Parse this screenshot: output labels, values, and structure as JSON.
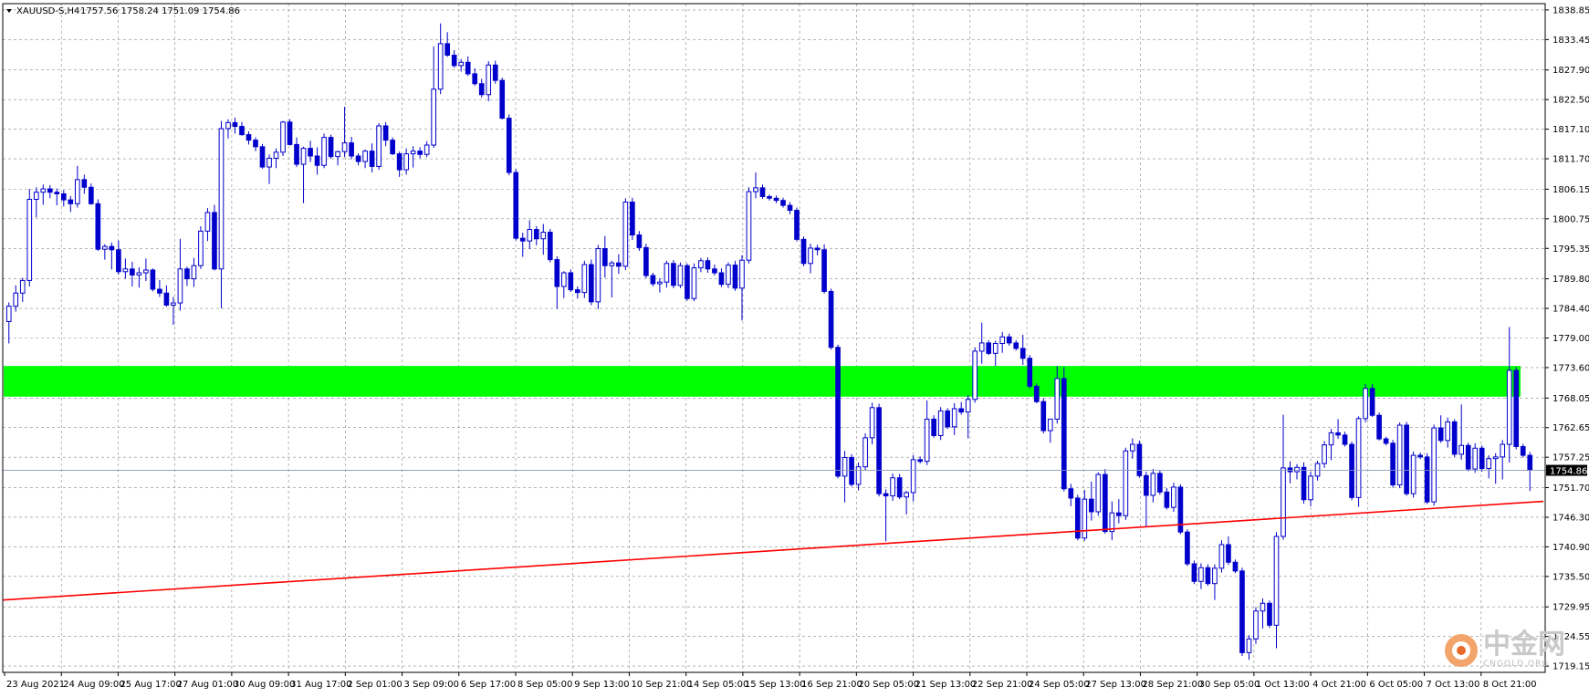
{
  "header": {
    "menu_arrow": "dropdown-arrow-icon",
    "symbol": "XAUUSD-S,H4",
    "ohlc": "1757.56 1758.24 1751.09 1754.86"
  },
  "price_label": "1754.86",
  "watermark": {
    "logo": "cngold-logo-icon",
    "text": "中金网",
    "url": "CNGOLD.ORG"
  },
  "colors": {
    "grid": "#8a8a8a",
    "bull_candle": "#ffffff",
    "bear_candle": "#0000cc",
    "wick": "#0000cc",
    "zone": "#00ff00",
    "trendline": "#ff0000",
    "price_line": "#8899bb",
    "price_label_bg": "#000000"
  },
  "chart_data": {
    "type": "candlestick",
    "symbol": "XAUUSD-S",
    "timeframe": "H4",
    "y_ticks": [
      "1838.85",
      "1833.45",
      "1827.90",
      "1822.50",
      "1817.10",
      "1811.70",
      "1806.15",
      "1800.75",
      "1795.35",
      "1789.80",
      "1784.40",
      "1779.00",
      "1773.60",
      "1768.05",
      "1762.65",
      "1757.25",
      "1751.70",
      "1746.30",
      "1740.90",
      "1735.50",
      "1729.95",
      "1724.55",
      "1719.15"
    ],
    "x_labels": [
      "23 Aug 2021",
      "24 Aug 09:00",
      "25 Aug 17:00",
      "27 Aug 01:00",
      "30 Aug 09:00",
      "31 Aug 17:00",
      "2 Sep 01:00",
      "3 Sep 09:00",
      "6 Sep 17:00",
      "8 Sep 05:00",
      "9 Sep 13:00",
      "10 Sep 21:00",
      "14 Sep 05:00",
      "15 Sep 13:00",
      "16 Sep 21:00",
      "20 Sep 05:00",
      "21 Sep 13:00",
      "22 Sep 21:00",
      "24 Sep 05:00",
      "27 Sep 13:00",
      "28 Sep 21:00",
      "30 Sep 05:00",
      "1 Oct 13:00",
      "4 Oct 21:00",
      "6 Oct 05:00",
      "7 Oct 13:00",
      "8 Oct 21:00"
    ],
    "ylim": [
      1718.0,
      1840.0
    ],
    "current_price": 1754.86,
    "resistance_zone": [
      1768.3,
      1773.9
    ],
    "trendline": [
      [
        0,
        1731.2
      ],
      [
        1537,
        1749.2
      ]
    ],
    "candles": [
      [
        1782.0,
        1785.5,
        1778.0,
        1784.8
      ],
      [
        1784.8,
        1788.6,
        1783.8,
        1787.2
      ],
      [
        1787.2,
        1790.0,
        1785.6,
        1789.5
      ],
      [
        1789.5,
        1806.2,
        1788.4,
        1804.3
      ],
      [
        1804.3,
        1806.5,
        1801.0,
        1805.6
      ],
      [
        1805.6,
        1807.0,
        1803.3,
        1806.2
      ],
      [
        1806.2,
        1806.9,
        1804.5,
        1805.6
      ],
      [
        1805.6,
        1806.3,
        1803.2,
        1805.3
      ],
      [
        1805.3,
        1806.0,
        1803.0,
        1804.2
      ],
      [
        1804.2,
        1804.9,
        1802.0,
        1803.5
      ],
      [
        1803.5,
        1810.4,
        1802.8,
        1807.9
      ],
      [
        1807.9,
        1808.8,
        1805.3,
        1806.5
      ],
      [
        1806.5,
        1807.2,
        1803.3,
        1803.5
      ],
      [
        1803.5,
        1804.3,
        1794.9,
        1795.2
      ],
      [
        1795.2,
        1796.1,
        1793.3,
        1795.7
      ],
      [
        1795.7,
        1796.4,
        1791.5,
        1795.1
      ],
      [
        1795.1,
        1796.8,
        1790.6,
        1791.1
      ],
      [
        1791.1,
        1793.5,
        1789.8,
        1791.6
      ],
      [
        1791.6,
        1792.9,
        1788.4,
        1790.5
      ],
      [
        1790.5,
        1791.9,
        1788.2,
        1790.9
      ],
      [
        1790.9,
        1793.5,
        1789.4,
        1791.4
      ],
      [
        1791.4,
        1791.7,
        1787.5,
        1787.9
      ],
      [
        1787.9,
        1789.6,
        1786.5,
        1787.2
      ],
      [
        1787.2,
        1788.6,
        1784.7,
        1785.0
      ],
      [
        1785.0,
        1786.5,
        1781.4,
        1785.4
      ],
      [
        1785.4,
        1797.1,
        1784.0,
        1791.6
      ],
      [
        1791.6,
        1792.0,
        1788.5,
        1789.8
      ],
      [
        1789.8,
        1793.6,
        1788.3,
        1792.2
      ],
      [
        1792.2,
        1799.4,
        1791.6,
        1798.5
      ],
      [
        1798.5,
        1802.7,
        1796.7,
        1801.9
      ],
      [
        1801.9,
        1803.3,
        1791.3,
        1791.6
      ],
      [
        1791.6,
        1818.6,
        1784.4,
        1817.2
      ],
      [
        1817.2,
        1818.9,
        1815.4,
        1818.3
      ],
      [
        1818.3,
        1819.2,
        1816.3,
        1817.6
      ],
      [
        1817.6,
        1818.4,
        1815.9,
        1816.1
      ],
      [
        1816.1,
        1816.7,
        1814.3,
        1815.1
      ],
      [
        1815.1,
        1815.6,
        1813.1,
        1813.9
      ],
      [
        1813.9,
        1814.4,
        1809.9,
        1810.2
      ],
      [
        1810.2,
        1812.5,
        1807.1,
        1811.8
      ],
      [
        1811.8,
        1813.6,
        1810.0,
        1812.9
      ],
      [
        1812.9,
        1818.6,
        1812.2,
        1818.4
      ],
      [
        1818.4,
        1818.9,
        1814.1,
        1814.3
      ],
      [
        1814.3,
        1815.6,
        1810.2,
        1810.7
      ],
      [
        1810.7,
        1813.9,
        1803.6,
        1813.6
      ],
      [
        1813.6,
        1815.0,
        1811.1,
        1812.2
      ],
      [
        1812.2,
        1813.8,
        1808.8,
        1810.5
      ],
      [
        1810.5,
        1816.3,
        1810.0,
        1815.6
      ],
      [
        1815.6,
        1816.1,
        1811.7,
        1812.1
      ],
      [
        1812.1,
        1813.2,
        1810.5,
        1813.0
      ],
      [
        1813.0,
        1821.2,
        1812.0,
        1814.6
      ],
      [
        1814.6,
        1815.7,
        1811.6,
        1812.2
      ],
      [
        1812.2,
        1812.7,
        1810.5,
        1811.2
      ],
      [
        1811.2,
        1813.4,
        1810.0,
        1813.1
      ],
      [
        1813.1,
        1814.5,
        1809.2,
        1810.3
      ],
      [
        1810.3,
        1818.2,
        1809.7,
        1817.7
      ],
      [
        1817.7,
        1818.4,
        1814.0,
        1815.1
      ],
      [
        1815.1,
        1815.6,
        1812.4,
        1812.6
      ],
      [
        1812.6,
        1813.0,
        1808.4,
        1809.7
      ],
      [
        1809.7,
        1813.6,
        1808.8,
        1812.6
      ],
      [
        1812.6,
        1814.0,
        1810.1,
        1813.1
      ],
      [
        1813.1,
        1813.8,
        1811.8,
        1812.5
      ],
      [
        1812.5,
        1814.9,
        1812.0,
        1814.2
      ],
      [
        1814.2,
        1832.2,
        1813.7,
        1824.4
      ],
      [
        1824.4,
        1836.4,
        1823.5,
        1832.7
      ],
      [
        1832.7,
        1834.8,
        1830.3,
        1830.6
      ],
      [
        1830.6,
        1831.5,
        1828.3,
        1828.7
      ],
      [
        1828.7,
        1829.9,
        1827.6,
        1829.3
      ],
      [
        1829.3,
        1830.4,
        1826.8,
        1827.2
      ],
      [
        1827.2,
        1828.2,
        1825.0,
        1825.4
      ],
      [
        1825.4,
        1826.3,
        1822.9,
        1823.4
      ],
      [
        1823.4,
        1829.5,
        1822.2,
        1828.8
      ],
      [
        1828.8,
        1829.6,
        1825.4,
        1826.0
      ],
      [
        1826.0,
        1826.5,
        1818.9,
        1819.1
      ],
      [
        1819.1,
        1819.8,
        1808.7,
        1809.2
      ],
      [
        1809.2,
        1809.8,
        1796.8,
        1797.2
      ],
      [
        1797.2,
        1798.2,
        1793.8,
        1796.7
      ],
      [
        1796.7,
        1800.5,
        1795.2,
        1798.8
      ],
      [
        1798.8,
        1799.4,
        1795.9,
        1797.1
      ],
      [
        1797.1,
        1799.8,
        1794.2,
        1798.3
      ],
      [
        1798.3,
        1798.9,
        1792.8,
        1793.3
      ],
      [
        1793.3,
        1793.9,
        1784.3,
        1788.4
      ],
      [
        1788.4,
        1791.2,
        1786.3,
        1790.9
      ],
      [
        1790.9,
        1791.5,
        1787.4,
        1787.8
      ],
      [
        1787.8,
        1788.4,
        1786.2,
        1787.3
      ],
      [
        1787.3,
        1793.1,
        1786.3,
        1792.4
      ],
      [
        1792.4,
        1793.3,
        1785.0,
        1785.6
      ],
      [
        1785.6,
        1796.0,
        1784.3,
        1795.3
      ],
      [
        1795.3,
        1797.6,
        1790.0,
        1792.2
      ],
      [
        1792.2,
        1793.1,
        1786.4,
        1792.7
      ],
      [
        1792.7,
        1794.3,
        1790.7,
        1792.1
      ],
      [
        1792.1,
        1804.5,
        1791.4,
        1803.8
      ],
      [
        1803.8,
        1804.6,
        1796.9,
        1797.8
      ],
      [
        1797.8,
        1798.5,
        1794.9,
        1795.5
      ],
      [
        1795.5,
        1796.2,
        1789.9,
        1790.4
      ],
      [
        1790.4,
        1790.9,
        1788.4,
        1788.9
      ],
      [
        1788.9,
        1789.9,
        1787.3,
        1789.2
      ],
      [
        1789.2,
        1793.1,
        1788.2,
        1792.6
      ],
      [
        1792.6,
        1793.2,
        1788.1,
        1788.6
      ],
      [
        1788.6,
        1792.8,
        1788.1,
        1792.2
      ],
      [
        1792.2,
        1792.6,
        1785.8,
        1786.2
      ],
      [
        1786.2,
        1792.6,
        1785.7,
        1791.8
      ],
      [
        1791.8,
        1793.6,
        1791.0,
        1793.1
      ],
      [
        1793.1,
        1793.7,
        1790.9,
        1791.6
      ],
      [
        1791.6,
        1792.4,
        1790.4,
        1790.9
      ],
      [
        1790.9,
        1791.7,
        1788.3,
        1788.8
      ],
      [
        1788.8,
        1792.8,
        1788.1,
        1792.3
      ],
      [
        1792.3,
        1793.1,
        1787.6,
        1788.1
      ],
      [
        1788.1,
        1794.1,
        1782.2,
        1793.2
      ],
      [
        1793.2,
        1806.5,
        1792.6,
        1805.7
      ],
      [
        1805.7,
        1809.2,
        1804.5,
        1806.4
      ],
      [
        1806.4,
        1807.0,
        1804.4,
        1804.8
      ],
      [
        1804.8,
        1805.2,
        1804.1,
        1804.5
      ],
      [
        1804.5,
        1805.0,
        1803.6,
        1804.1
      ],
      [
        1804.1,
        1804.6,
        1802.8,
        1803.2
      ],
      [
        1803.2,
        1803.8,
        1801.6,
        1802.3
      ],
      [
        1802.3,
        1802.8,
        1796.6,
        1797.0
      ],
      [
        1797.0,
        1797.5,
        1792.1,
        1792.6
      ],
      [
        1792.6,
        1796.2,
        1790.8,
        1795.4
      ],
      [
        1795.4,
        1796.0,
        1794.1,
        1795.1
      ],
      [
        1795.1,
        1796.1,
        1787.1,
        1787.5
      ],
      [
        1787.5,
        1788.0,
        1776.9,
        1777.3
      ],
      [
        1777.3,
        1777.8,
        1753.4,
        1753.8
      ],
      [
        1753.8,
        1758.4,
        1749.0,
        1757.2
      ],
      [
        1757.2,
        1757.8,
        1751.9,
        1752.3
      ],
      [
        1752.3,
        1756.3,
        1751.2,
        1755.5
      ],
      [
        1755.5,
        1761.6,
        1754.8,
        1760.8
      ],
      [
        1760.8,
        1767.2,
        1759.6,
        1766.3
      ],
      [
        1766.3,
        1767.0,
        1750.1,
        1750.6
      ],
      [
        1750.6,
        1751.4,
        1741.9,
        1750.2
      ],
      [
        1750.2,
        1754.3,
        1749.3,
        1753.5
      ],
      [
        1753.5,
        1754.2,
        1749.6,
        1750.0
      ],
      [
        1750.0,
        1751.1,
        1746.8,
        1750.8
      ],
      [
        1750.8,
        1757.6,
        1749.2,
        1756.8
      ],
      [
        1756.8,
        1757.4,
        1756.1,
        1756.5
      ],
      [
        1756.5,
        1767.6,
        1755.8,
        1764.2
      ],
      [
        1764.2,
        1764.9,
        1760.8,
        1761.2
      ],
      [
        1761.2,
        1766.4,
        1760.4,
        1765.7
      ],
      [
        1765.7,
        1766.2,
        1762.4,
        1762.8
      ],
      [
        1762.8,
        1767.1,
        1761.3,
        1766.1
      ],
      [
        1766.1,
        1767.3,
        1765.0,
        1765.5
      ],
      [
        1765.5,
        1768.6,
        1760.7,
        1767.8
      ],
      [
        1767.8,
        1777.3,
        1767.2,
        1776.6
      ],
      [
        1776.6,
        1781.8,
        1774.3,
        1778.1
      ],
      [
        1778.1,
        1778.6,
        1775.9,
        1776.2
      ],
      [
        1776.2,
        1778.5,
        1773.9,
        1778.0
      ],
      [
        1778.0,
        1780.1,
        1776.3,
        1779.2
      ],
      [
        1779.2,
        1779.8,
        1777.6,
        1778.1
      ],
      [
        1778.1,
        1778.6,
        1776.7,
        1777.1
      ],
      [
        1777.1,
        1779.6,
        1774.1,
        1775.3
      ],
      [
        1775.3,
        1775.9,
        1769.8,
        1770.2
      ],
      [
        1770.2,
        1770.7,
        1767.1,
        1767.4
      ],
      [
        1767.4,
        1768.0,
        1761.6,
        1762.1
      ],
      [
        1762.1,
        1763.0,
        1759.9,
        1764.2
      ],
      [
        1764.2,
        1773.9,
        1763.4,
        1771.6
      ],
      [
        1771.6,
        1773.7,
        1751.0,
        1751.5
      ],
      [
        1751.5,
        1752.4,
        1748.3,
        1749.8
      ],
      [
        1749.8,
        1750.4,
        1742.1,
        1742.5
      ],
      [
        1742.5,
        1751.3,
        1742.0,
        1749.6
      ],
      [
        1749.6,
        1752.8,
        1745.7,
        1747.3
      ],
      [
        1747.3,
        1754.5,
        1746.6,
        1754.1
      ],
      [
        1754.1,
        1755.1,
        1743.3,
        1743.7
      ],
      [
        1743.7,
        1749.2,
        1742.1,
        1747.1
      ],
      [
        1747.1,
        1749.6,
        1745.2,
        1746.6
      ],
      [
        1746.6,
        1759.0,
        1745.8,
        1758.4
      ],
      [
        1758.4,
        1760.7,
        1757.0,
        1759.6
      ],
      [
        1759.6,
        1760.3,
        1753.5,
        1753.9
      ],
      [
        1753.9,
        1754.6,
        1744.5,
        1750.3
      ],
      [
        1750.3,
        1755.1,
        1749.0,
        1754.3
      ],
      [
        1754.3,
        1754.9,
        1750.4,
        1750.9
      ],
      [
        1750.9,
        1751.6,
        1747.7,
        1748.1
      ],
      [
        1748.1,
        1752.6,
        1747.3,
        1751.8
      ],
      [
        1751.8,
        1752.3,
        1743.2,
        1743.6
      ],
      [
        1743.6,
        1744.1,
        1737.4,
        1737.8
      ],
      [
        1737.8,
        1738.4,
        1734.1,
        1734.6
      ],
      [
        1734.6,
        1737.9,
        1733.2,
        1737.1
      ],
      [
        1737.1,
        1737.7,
        1733.8,
        1734.2
      ],
      [
        1734.2,
        1737.7,
        1731.2,
        1737.0
      ],
      [
        1737.0,
        1742.1,
        1736.2,
        1741.3
      ],
      [
        1741.3,
        1742.8,
        1737.6,
        1738.1
      ],
      [
        1738.1,
        1738.6,
        1736.1,
        1736.5
      ],
      [
        1736.5,
        1737.1,
        1721.0,
        1721.6
      ],
      [
        1721.6,
        1724.8,
        1720.3,
        1724.1
      ],
      [
        1724.1,
        1729.9,
        1723.2,
        1729.2
      ],
      [
        1729.2,
        1731.5,
        1726.0,
        1730.6
      ],
      [
        1730.6,
        1731.1,
        1726.1,
        1726.6
      ],
      [
        1726.6,
        1743.6,
        1722.4,
        1742.8
      ],
      [
        1742.8,
        1765.0,
        1742.2,
        1755.3
      ],
      [
        1755.3,
        1756.5,
        1752.5,
        1754.6
      ],
      [
        1754.6,
        1756.0,
        1753.2,
        1755.4
      ],
      [
        1755.4,
        1756.3,
        1748.8,
        1749.5
      ],
      [
        1749.5,
        1754.6,
        1748.3,
        1753.8
      ],
      [
        1753.8,
        1756.6,
        1753.0,
        1756.1
      ],
      [
        1756.1,
        1760.2,
        1755.3,
        1759.5
      ],
      [
        1759.5,
        1762.4,
        1756.7,
        1761.7
      ],
      [
        1761.7,
        1764.2,
        1760.6,
        1761.3
      ],
      [
        1761.3,
        1761.9,
        1759.2,
        1759.6
      ],
      [
        1759.6,
        1760.1,
        1749.4,
        1749.9
      ],
      [
        1749.9,
        1764.7,
        1748.2,
        1764.3
      ],
      [
        1764.3,
        1770.6,
        1763.6,
        1769.8
      ],
      [
        1769.8,
        1770.6,
        1764.6,
        1764.9
      ],
      [
        1764.9,
        1765.4,
        1760.3,
        1760.6
      ],
      [
        1760.6,
        1761.0,
        1759.4,
        1759.8
      ],
      [
        1759.8,
        1760.4,
        1751.7,
        1752.2
      ],
      [
        1752.2,
        1763.6,
        1751.6,
        1763.1
      ],
      [
        1763.1,
        1763.7,
        1750.2,
        1750.6
      ],
      [
        1750.6,
        1758.3,
        1749.9,
        1757.6
      ],
      [
        1757.6,
        1758.1,
        1756.9,
        1757.3
      ],
      [
        1757.3,
        1758.0,
        1748.7,
        1749.1
      ],
      [
        1749.1,
        1763.2,
        1748.4,
        1762.6
      ],
      [
        1762.6,
        1764.9,
        1759.9,
        1760.3
      ],
      [
        1760.3,
        1764.5,
        1759.0,
        1763.7
      ],
      [
        1763.7,
        1764.2,
        1757.3,
        1757.8
      ],
      [
        1757.8,
        1766.9,
        1756.8,
        1759.4
      ],
      [
        1759.4,
        1759.9,
        1754.7,
        1755.1
      ],
      [
        1755.1,
        1759.8,
        1754.4,
        1758.9
      ],
      [
        1758.9,
        1759.4,
        1754.6,
        1755.2
      ],
      [
        1755.2,
        1757.6,
        1753.4,
        1757.0
      ],
      [
        1757.0,
        1758.0,
        1752.4,
        1757.3
      ],
      [
        1757.3,
        1760.4,
        1753.2,
        1759.6
      ],
      [
        1759.6,
        1781.0,
        1756.3,
        1773.1
      ],
      [
        1773.1,
        1773.7,
        1758.7,
        1759.2
      ],
      [
        1759.2,
        1759.7,
        1757.2,
        1757.6
      ],
      [
        1757.6,
        1758.2,
        1751.1,
        1754.9
      ]
    ]
  }
}
